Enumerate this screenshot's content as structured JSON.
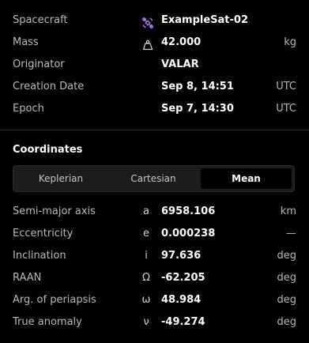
{
  "header": {
    "spacecraft": {
      "label": "Spacecraft",
      "value": "ExampleSat-02",
      "icon": "satellite-icon"
    },
    "mass": {
      "label": "Mass",
      "value": "42.000",
      "unit": "kg",
      "icon": "weight-icon"
    },
    "originator": {
      "label": "Originator",
      "value": "VALAR"
    },
    "creation_date": {
      "label": "Creation Date",
      "value": "Sep 8, 14:51",
      "unit": "UTC"
    },
    "epoch": {
      "label": "Epoch",
      "value": "Sep 7, 14:30",
      "unit": "UTC"
    }
  },
  "coordinates": {
    "title": "Coordinates",
    "tabs": [
      {
        "label": "Keplerian",
        "active": false
      },
      {
        "label": "Cartesian",
        "active": false
      },
      {
        "label": "Mean",
        "active": true
      }
    ],
    "rows": [
      {
        "label": "Semi-major axis",
        "symbol": "a",
        "value": "6958.106",
        "unit": "km"
      },
      {
        "label": "Eccentricity",
        "symbol": "e",
        "value": "0.000238",
        "unit": "—"
      },
      {
        "label": "Inclination",
        "symbol": "i",
        "value": "97.636",
        "unit": "deg"
      },
      {
        "label": "RAAN",
        "symbol": "Ω",
        "value": "-62.205",
        "unit": "deg"
      },
      {
        "label": "Arg. of periapsis",
        "symbol": "ω",
        "value": "48.984",
        "unit": "deg"
      },
      {
        "label": "True anomaly",
        "symbol": "ν",
        "value": "-49.274",
        "unit": "deg"
      }
    ]
  },
  "colors": {
    "accent": "#b57bff",
    "background": "#000000",
    "label": "#b8b8b8"
  }
}
